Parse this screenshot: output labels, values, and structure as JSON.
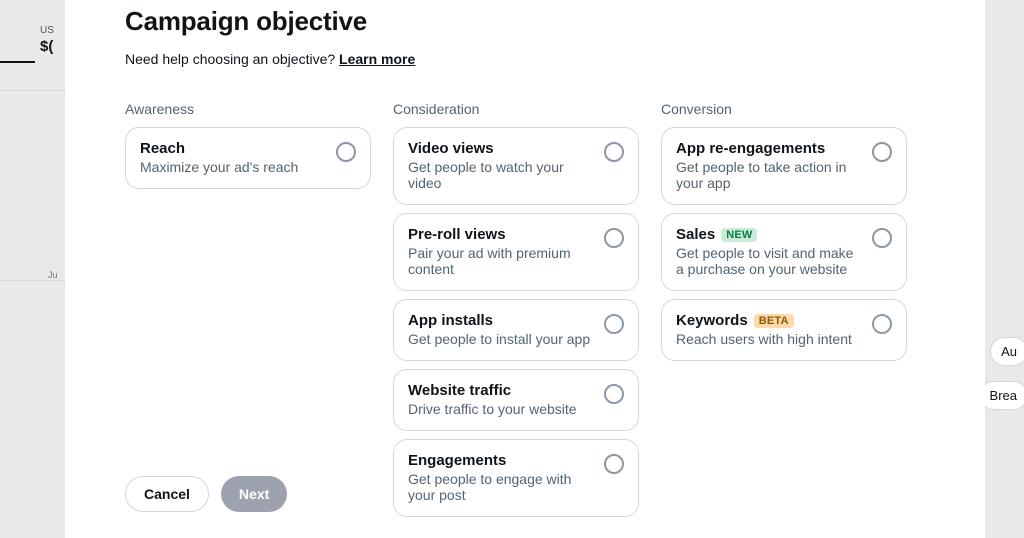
{
  "backdrop": {
    "usd_label": "US",
    "dollar": "$(",
    "ju": "Ju",
    "right_pill_au": "Au",
    "right_pill_brea": "Brea"
  },
  "header": {
    "title": "Campaign objective",
    "help_text": "Need help choosing an objective? ",
    "learn_more": "Learn more"
  },
  "columns": [
    {
      "title": "Awareness",
      "cards": [
        {
          "title": "Reach",
          "desc": "Maximize your ad's reach",
          "badge": null
        }
      ]
    },
    {
      "title": "Consideration",
      "cards": [
        {
          "title": "Video views",
          "desc": "Get people to watch your video",
          "badge": null
        },
        {
          "title": "Pre-roll views",
          "desc": "Pair your ad with premium content",
          "badge": null
        },
        {
          "title": "App installs",
          "desc": "Get people to install your app",
          "badge": null
        },
        {
          "title": "Website traffic",
          "desc": "Drive traffic to your website",
          "badge": null
        },
        {
          "title": "Engagements",
          "desc": "Get people to engage with your post",
          "badge": null
        }
      ]
    },
    {
      "title": "Conversion",
      "cards": [
        {
          "title": "App re-engagements",
          "desc": "Get people to take action in your app",
          "badge": null
        },
        {
          "title": "Sales",
          "desc": "Get people to visit and make a purchase on your website",
          "badge": "NEW"
        },
        {
          "title": "Keywords",
          "desc": "Reach users with high intent",
          "badge": "BETA"
        }
      ]
    }
  ],
  "footer": {
    "cancel": "Cancel",
    "next": "Next"
  }
}
